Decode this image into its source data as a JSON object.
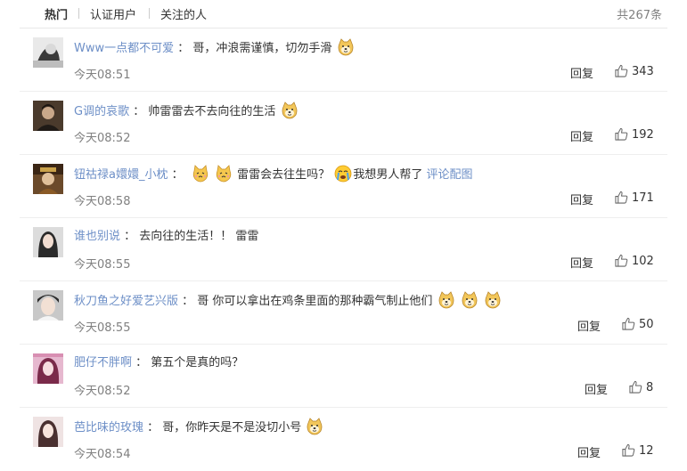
{
  "tabs": [
    {
      "label": "热门",
      "active": true
    },
    {
      "label": "认证用户",
      "active": false
    },
    {
      "label": "关注的人",
      "active": false
    }
  ],
  "total": "共267条",
  "reply_label": "回复",
  "colors": {
    "username": "#6d8fc7",
    "text": "#333333",
    "meta": "#808080"
  },
  "comments": [
    {
      "username": "Www一点都不可爱",
      "text": "哥，冲浪需谨慎，切勿手滑",
      "emojis": [
        "doge-icon"
      ],
      "time": "今天08:51",
      "likes": "343"
    },
    {
      "username": "G调的哀歌",
      "text": "帅雷雷去不去向往的生活",
      "emojis": [
        "doge-icon"
      ],
      "time": "今天08:52",
      "likes": "192"
    },
    {
      "username": "钮祜禄a嬛嬛_小枕",
      "text_before": "",
      "text_middle": "雷雷会去往生吗？",
      "text_after": "我想男人帮了",
      "link": "评论配图",
      "time": "今天08:58",
      "likes": "171"
    },
    {
      "username": "谁也别说",
      "text": "去向往的生活！！ 雷雷",
      "time": "今天08:55",
      "likes": "102"
    },
    {
      "username": "秋刀鱼之好爱艺兴版",
      "text": "哥 你可以拿出在鸡条里面的那种霸气制止他们",
      "emojis": [
        "doge-icon",
        "doge-icon",
        "doge-icon"
      ],
      "time": "今天08:55",
      "likes": "50"
    },
    {
      "username": "肥仔不胖啊",
      "text": "第五个是真的吗？",
      "time": "今天08:52",
      "likes": "8"
    },
    {
      "username": "芭比味的玫瑰",
      "text": "哥，你昨天是不是没切小号",
      "emojis": [
        "doge-icon"
      ],
      "time": "今天08:54",
      "likes": "12"
    }
  ]
}
